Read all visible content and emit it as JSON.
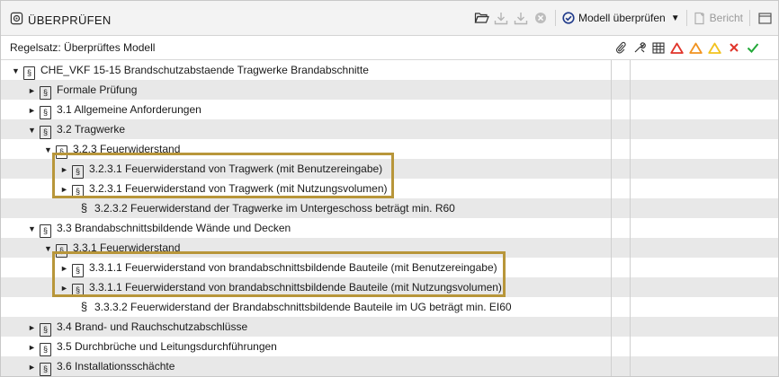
{
  "titlebar": {
    "title": "ÜBERPRÜFEN",
    "check_label": "Modell überprüfen",
    "report_label": "Bericht"
  },
  "header": {
    "ruleset_label": "Regelsatz: Überprüftes Modell"
  },
  "status_colors": {
    "error": "#e0342a",
    "warning": "#f19320",
    "info": "#f2c21e",
    "ok": "#22a838",
    "highlight": "#b8963a"
  },
  "tree": [
    {
      "label": "CHE_VKF 15-15 Brandschutzabstaende Tragwerke Brandabschnitte",
      "level": 0,
      "expanded": true,
      "icon": "para-box"
    },
    {
      "label": "Formale Prüfung",
      "level": 1,
      "expanded": false,
      "icon": "para-box"
    },
    {
      "label": "3.1 Allgemeine Anforderungen",
      "level": 1,
      "expanded": false,
      "icon": "para-box"
    },
    {
      "label": "3.2 Tragwerke",
      "level": 1,
      "expanded": true,
      "icon": "para-box"
    },
    {
      "label": "3.2.3 Feuerwiderstand",
      "level": 2,
      "expanded": true,
      "icon": "para-box"
    },
    {
      "label": "3.2.3.1 Feuerwiderstand von Tragwerk (mit Benutzereingabe)",
      "level": 3,
      "expanded": false,
      "icon": "para-box"
    },
    {
      "label": "3.2.3.1 Feuerwiderstand von Tragwerk (mit Nutzungsvolumen)",
      "level": 3,
      "expanded": false,
      "icon": "para-box"
    },
    {
      "label": "3.2.3.2 Feuerwiderstand der Tragwerke im Untergeschoss beträgt min. R60",
      "level": 3,
      "leaf": true,
      "icon": "para"
    },
    {
      "label": "3.3 Brandabschnittsbildende Wände und Decken",
      "level": 1,
      "expanded": true,
      "icon": "para-box"
    },
    {
      "label": "3.3.1 Feuerwiderstand",
      "level": 2,
      "expanded": true,
      "icon": "para-box"
    },
    {
      "label": "3.3.1.1 Feuerwiderstand von brandabschnittsbildende Bauteile (mit Benutzereingabe)",
      "level": 3,
      "expanded": false,
      "icon": "para-box"
    },
    {
      "label": "3.3.1.1 Feuerwiderstand von brandabschnittsbildende Bauteile (mit Nutzungsvolumen)",
      "level": 3,
      "expanded": false,
      "icon": "para-box"
    },
    {
      "label": "3.3.3.2 Feuerwiderstand der Brandabschnittsbildende Bauteile im UG beträgt min. EI60",
      "level": 3,
      "leaf": true,
      "icon": "para"
    },
    {
      "label": "3.4 Brand- und Rauchschutzabschlüsse",
      "level": 1,
      "expanded": false,
      "icon": "para-box"
    },
    {
      "label": "3.5 Durchbrüche und Leitungsdurchführungen",
      "level": 1,
      "expanded": false,
      "icon": "para-box"
    },
    {
      "label": "3.6 Installationsschächte",
      "level": 1,
      "expanded": false,
      "icon": "para-box"
    }
  ]
}
